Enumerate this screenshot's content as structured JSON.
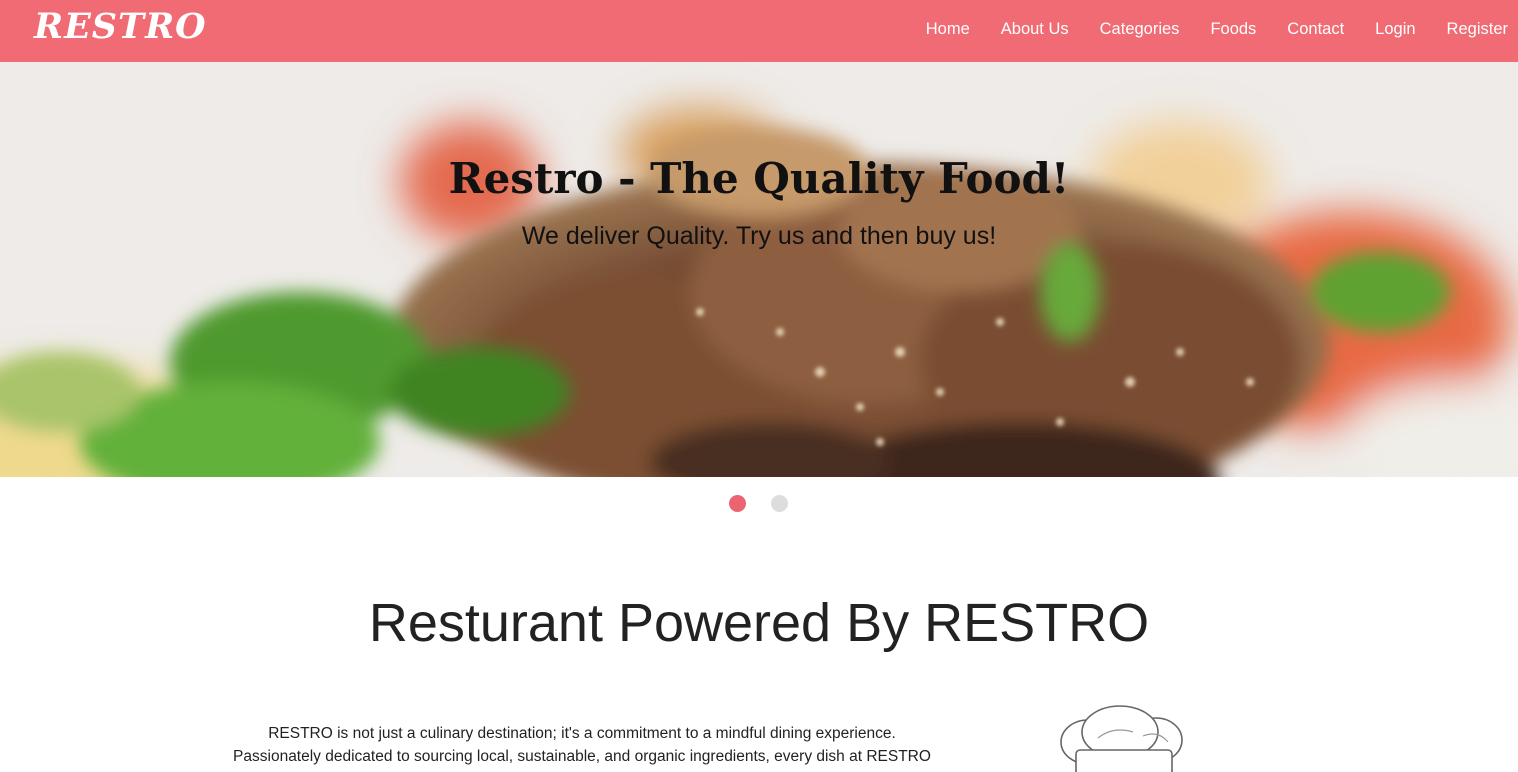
{
  "nav": {
    "brand": "RESTRO",
    "links": [
      {
        "label": "Home"
      },
      {
        "label": "About Us"
      },
      {
        "label": "Categories"
      },
      {
        "label": "Foods"
      },
      {
        "label": "Contact"
      },
      {
        "label": "Login"
      },
      {
        "label": "Register"
      }
    ],
    "background": "#f06b73"
  },
  "hero": {
    "title": "Restro - The Quality Food!",
    "subtitle": "We deliver Quality. Try us and then buy us!",
    "slides": 2,
    "active_slide": 1
  },
  "about": {
    "title": "Resturant Powered By RESTRO",
    "line1": "RESTRO is not just a culinary destination; it's a commitment to a mindful dining experience.",
    "line2": "Passionately dedicated to sourcing local, sustainable, and organic ingredients, every dish at RESTRO",
    "icon": "chef-hat-icon"
  },
  "colors": {
    "accent": "#ea6571",
    "dot_inactive": "#dddddd"
  }
}
